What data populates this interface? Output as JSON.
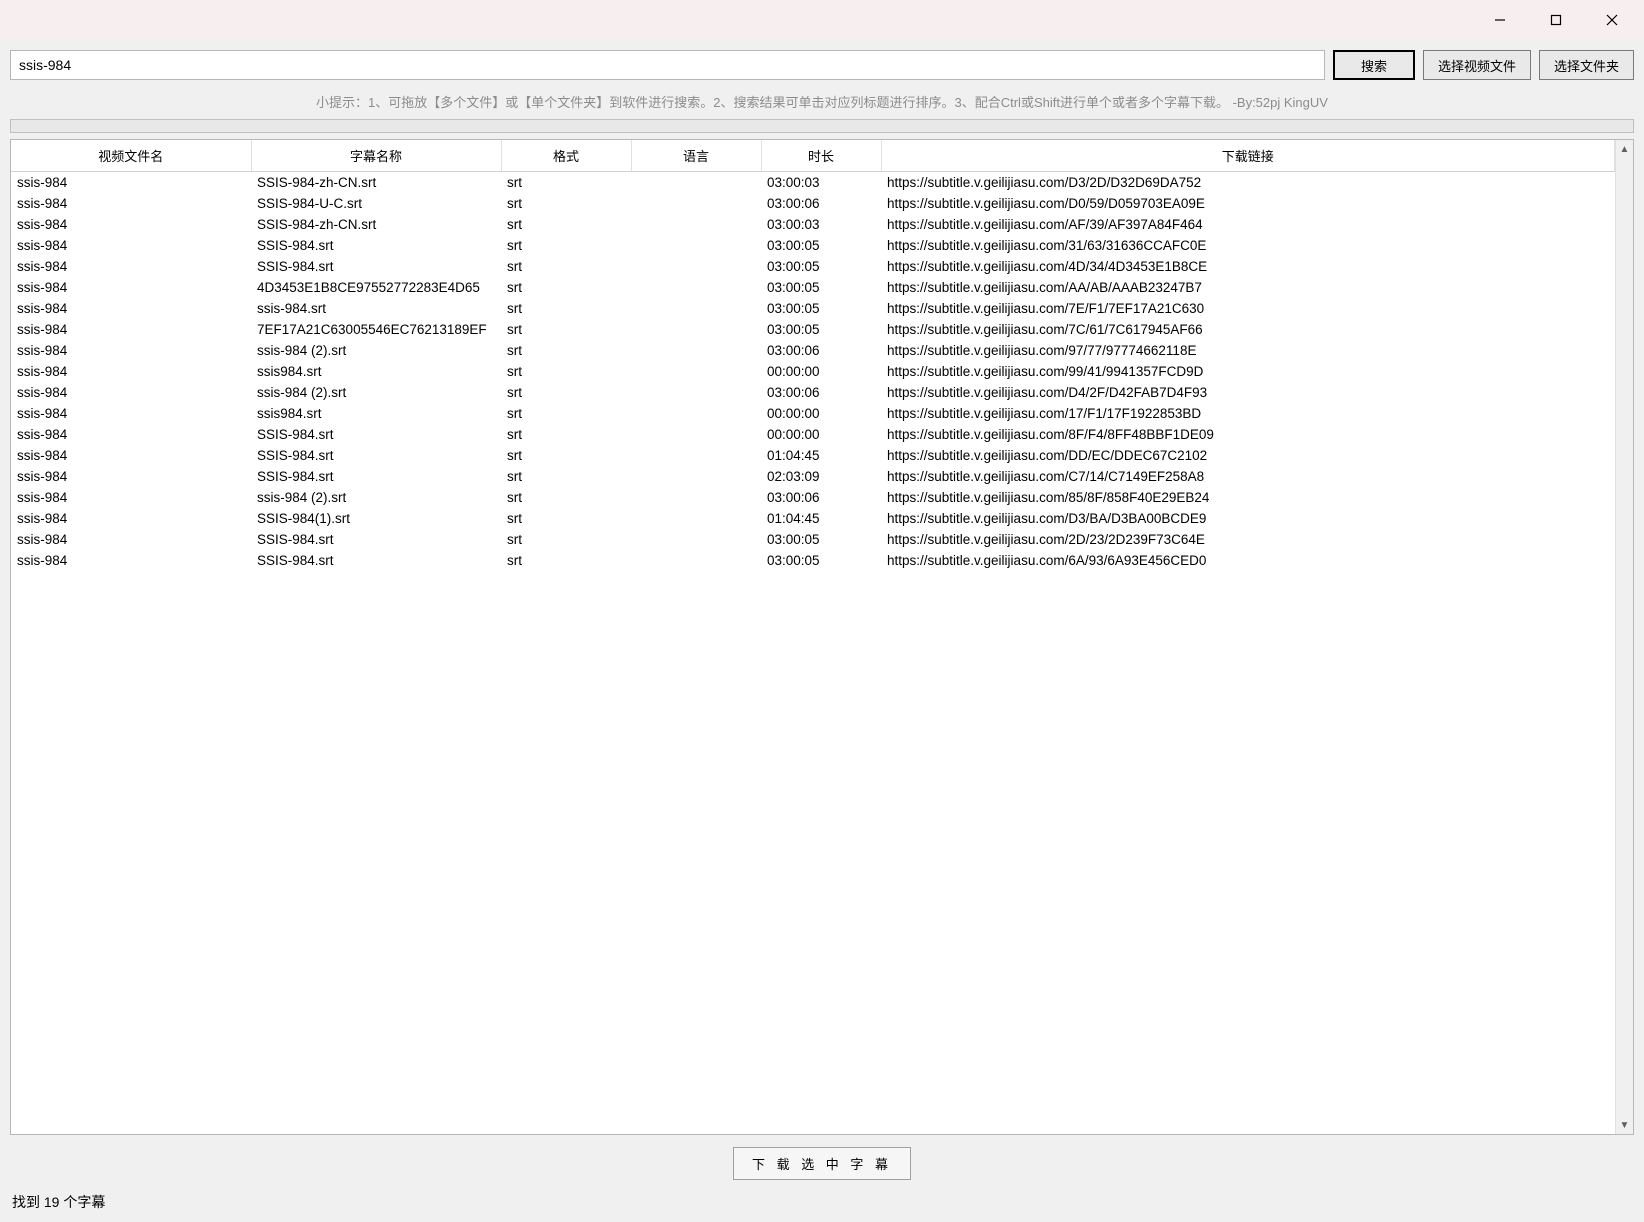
{
  "titlebar": {
    "minimize": "minimize",
    "maximize": "maximize",
    "close": "close"
  },
  "toolbar": {
    "search_value": "ssis-984",
    "search_button": "搜索",
    "select_video_button": "选择视频文件",
    "select_folder_button": "选择文件夹"
  },
  "hint": "小提示：1、可拖放【多个文件】或【单个文件夹】到软件进行搜索。2、搜索结果可单击对应列标题进行排序。3、配合Ctrl或Shift进行单个或者多个字幕下载。  -By:52pj KingUV",
  "columns": {
    "video": "视频文件名",
    "subtitle": "字幕名称",
    "format": "格式",
    "language": "语言",
    "duration": "时长",
    "link": "下载链接"
  },
  "rows": [
    {
      "video": "ssis-984",
      "subtitle": "SSIS-984-zh-CN.srt",
      "format": "srt",
      "language": "",
      "duration": "03:00:03",
      "link": "https://subtitle.v.geilijiasu.com/D3/2D/D32D69DA752"
    },
    {
      "video": "ssis-984",
      "subtitle": "SSIS-984-U-C.srt",
      "format": "srt",
      "language": "",
      "duration": "03:00:06",
      "link": "https://subtitle.v.geilijiasu.com/D0/59/D059703EA09E"
    },
    {
      "video": "ssis-984",
      "subtitle": "SSIS-984-zh-CN.srt",
      "format": "srt",
      "language": "",
      "duration": "03:00:03",
      "link": "https://subtitle.v.geilijiasu.com/AF/39/AF397A84F464"
    },
    {
      "video": "ssis-984",
      "subtitle": "SSIS-984.srt",
      "format": "srt",
      "language": "",
      "duration": "03:00:05",
      "link": "https://subtitle.v.geilijiasu.com/31/63/31636CCAFC0E"
    },
    {
      "video": "ssis-984",
      "subtitle": "SSIS-984.srt",
      "format": "srt",
      "language": "",
      "duration": "03:00:05",
      "link": "https://subtitle.v.geilijiasu.com/4D/34/4D3453E1B8CE"
    },
    {
      "video": "ssis-984",
      "subtitle": "4D3453E1B8CE97552772283E4D65",
      "format": "srt",
      "language": "",
      "duration": "03:00:05",
      "link": "https://subtitle.v.geilijiasu.com/AA/AB/AAAB23247B7"
    },
    {
      "video": "ssis-984",
      "subtitle": "ssis-984.srt",
      "format": "srt",
      "language": "",
      "duration": "03:00:05",
      "link": "https://subtitle.v.geilijiasu.com/7E/F1/7EF17A21C630"
    },
    {
      "video": "ssis-984",
      "subtitle": "7EF17A21C63005546EC76213189EF",
      "format": "srt",
      "language": "",
      "duration": "03:00:05",
      "link": "https://subtitle.v.geilijiasu.com/7C/61/7C617945AF66"
    },
    {
      "video": "ssis-984",
      "subtitle": "ssis-984 (2).srt",
      "format": "srt",
      "language": "",
      "duration": "03:00:06",
      "link": "https://subtitle.v.geilijiasu.com/97/77/97774662118E"
    },
    {
      "video": "ssis-984",
      "subtitle": "ssis984.srt",
      "format": "srt",
      "language": "",
      "duration": "00:00:00",
      "link": "https://subtitle.v.geilijiasu.com/99/41/9941357FCD9D"
    },
    {
      "video": "ssis-984",
      "subtitle": "ssis-984 (2).srt",
      "format": "srt",
      "language": "",
      "duration": "03:00:06",
      "link": "https://subtitle.v.geilijiasu.com/D4/2F/D42FAB7D4F93"
    },
    {
      "video": "ssis-984",
      "subtitle": "ssis984.srt",
      "format": "srt",
      "language": "",
      "duration": "00:00:00",
      "link": "https://subtitle.v.geilijiasu.com/17/F1/17F1922853BD"
    },
    {
      "video": "ssis-984",
      "subtitle": "SSIS-984.srt",
      "format": "srt",
      "language": "",
      "duration": "00:00:00",
      "link": "https://subtitle.v.geilijiasu.com/8F/F4/8FF48BBF1DE09"
    },
    {
      "video": "ssis-984",
      "subtitle": "SSIS-984.srt",
      "format": "srt",
      "language": "",
      "duration": "01:04:45",
      "link": "https://subtitle.v.geilijiasu.com/DD/EC/DDEC67C2102"
    },
    {
      "video": "ssis-984",
      "subtitle": "SSIS-984.srt",
      "format": "srt",
      "language": "",
      "duration": "02:03:09",
      "link": "https://subtitle.v.geilijiasu.com/C7/14/C7149EF258A8"
    },
    {
      "video": "ssis-984",
      "subtitle": "ssis-984 (2).srt",
      "format": "srt",
      "language": "",
      "duration": "03:00:06",
      "link": "https://subtitle.v.geilijiasu.com/85/8F/858F40E29EB24"
    },
    {
      "video": "ssis-984",
      "subtitle": "SSIS-984(1).srt",
      "format": "srt",
      "language": "",
      "duration": "01:04:45",
      "link": "https://subtitle.v.geilijiasu.com/D3/BA/D3BA00BCDE9"
    },
    {
      "video": "ssis-984",
      "subtitle": "SSIS-984.srt",
      "format": "srt",
      "language": "",
      "duration": "03:00:05",
      "link": "https://subtitle.v.geilijiasu.com/2D/23/2D239F73C64E"
    },
    {
      "video": "ssis-984",
      "subtitle": "SSIS-984.srt",
      "format": "srt",
      "language": "",
      "duration": "03:00:05",
      "link": "https://subtitle.v.geilijiasu.com/6A/93/6A93E456CED0"
    }
  ],
  "footer": {
    "download_selected": "下 载 选 中 字 幕"
  },
  "status": "找到 19 个字幕",
  "col_widths": {
    "video": "240px",
    "subtitle": "250px",
    "format": "130px",
    "language": "130px",
    "duration": "120px",
    "link": "auto"
  }
}
